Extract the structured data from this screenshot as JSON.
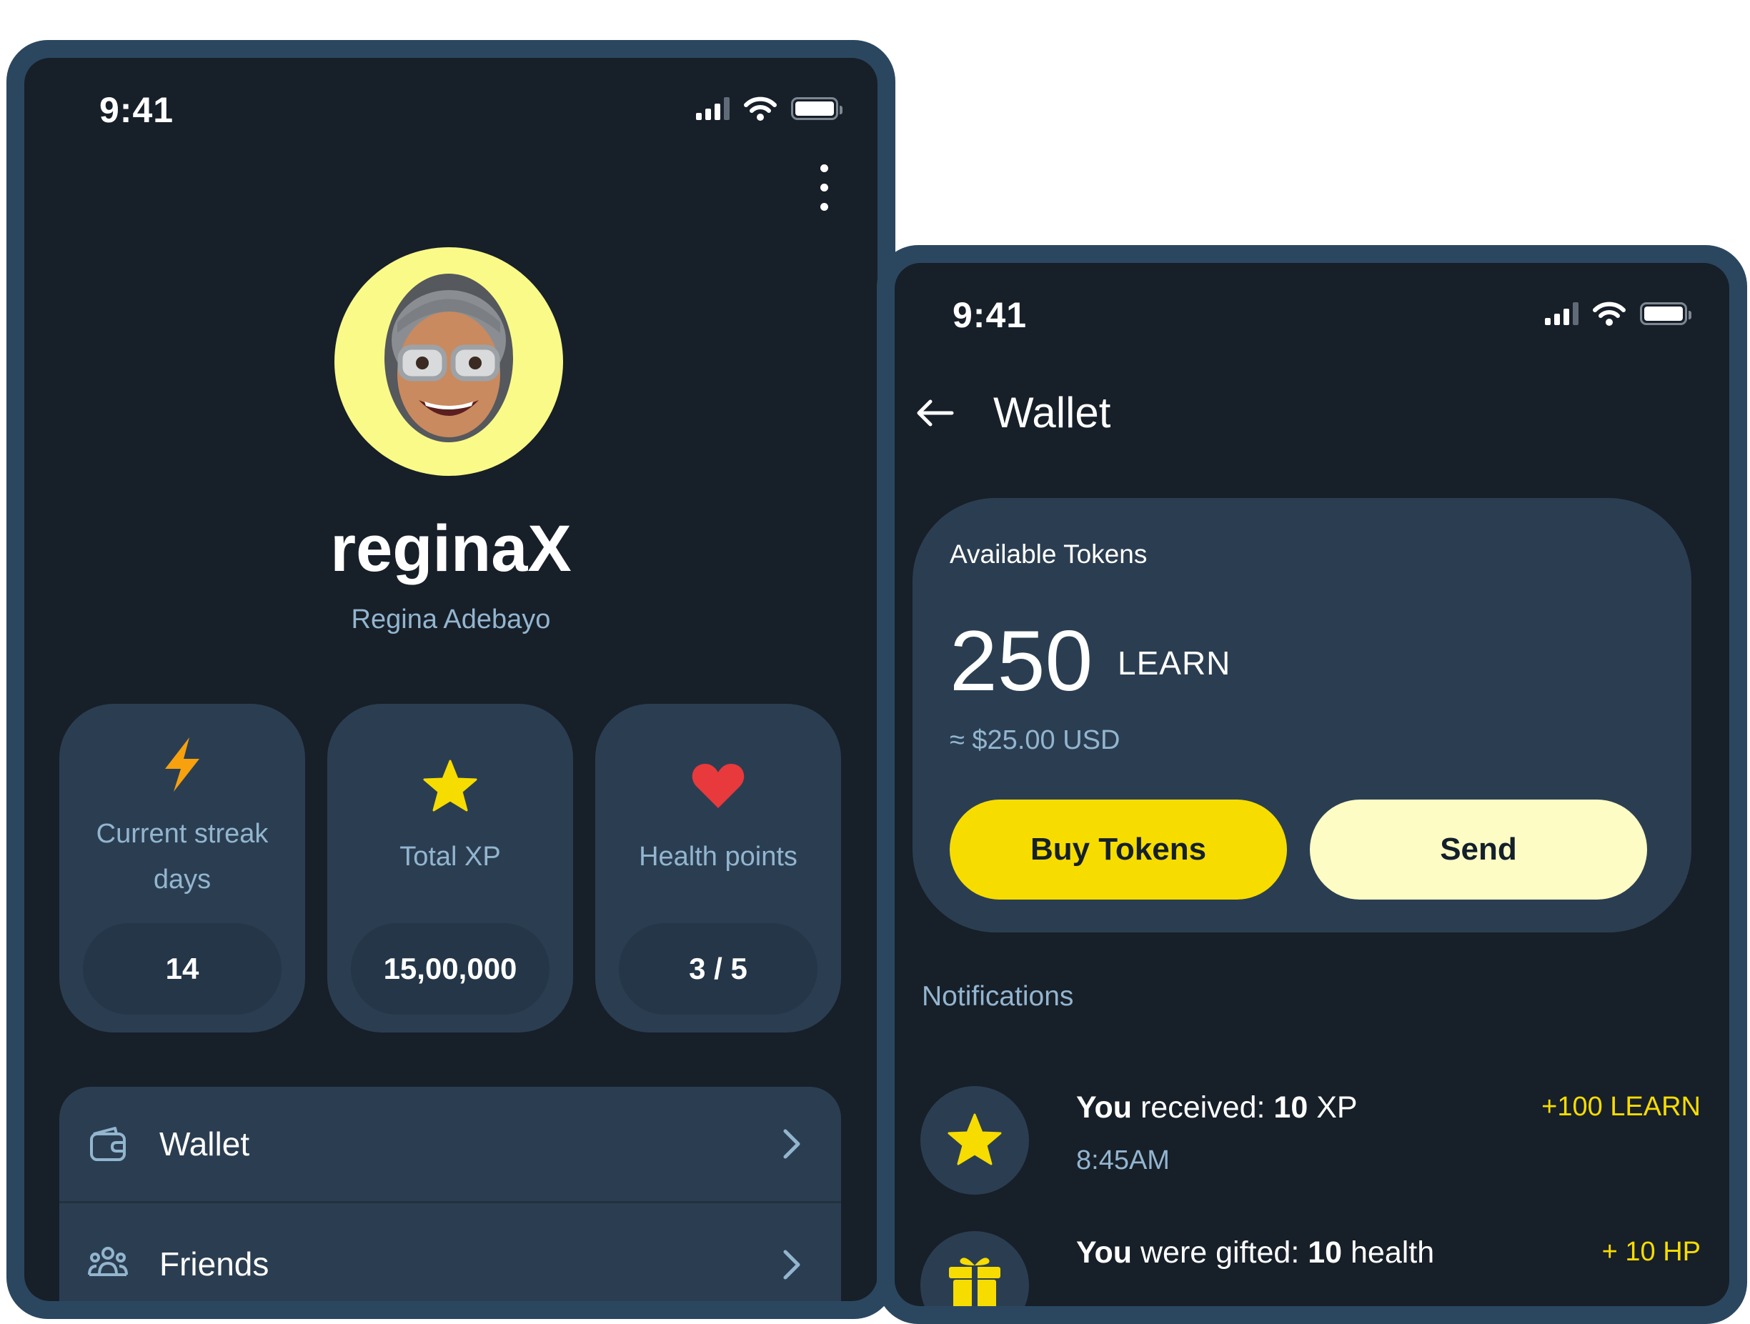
{
  "profile_screen": {
    "status_time": "9:41",
    "username": "reginaX",
    "full_name": "Regina Adebayo",
    "stats": [
      {
        "icon": "lightning-icon",
        "label_line1": "Current streak",
        "label_line2": "days",
        "value": "14"
      },
      {
        "icon": "star-icon",
        "label": "Total XP",
        "value": "15,00,000"
      },
      {
        "icon": "heart-icon",
        "label": "Health points",
        "value": "3 / 5"
      }
    ],
    "menu": [
      {
        "icon": "wallet-icon",
        "label": "Wallet"
      },
      {
        "icon": "friends-icon",
        "label": "Friends"
      }
    ]
  },
  "wallet_screen": {
    "status_time": "9:41",
    "title": "Wallet",
    "card": {
      "heading": "Available Tokens",
      "amount": "250",
      "unit": "LEARN",
      "usd": "≈ $25.00 USD",
      "buy_label": "Buy Tokens",
      "send_label": "Send"
    },
    "notifications_heading": "Notifications",
    "notifications": [
      {
        "icon": "star-icon",
        "prefix": "You",
        "middle": " received: ",
        "amount": "10",
        "suffix": " XP",
        "time": "8:45AM",
        "reward": "+100 LEARN"
      },
      {
        "icon": "gift-icon",
        "prefix": "You",
        "middle": " were gifted: ",
        "amount": "10",
        "suffix": " health",
        "reward": "+ 10 HP"
      }
    ]
  },
  "colors": {
    "frame": "#2b4760",
    "screen_bg": "#171f29",
    "card_bg": "#2b3e51",
    "accent_yellow": "#f7dc00",
    "muted_blue": "#93b5cf",
    "avatar_bg": "#fafa88"
  }
}
